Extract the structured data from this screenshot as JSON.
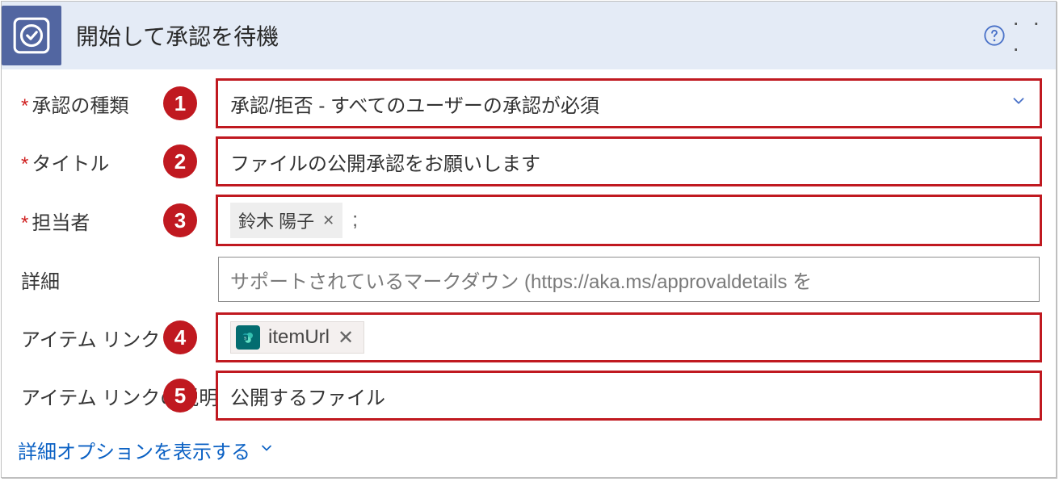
{
  "header": {
    "title": "開始して承認を待機",
    "icon_name": "approval-check-icon",
    "help_name": "help-icon",
    "more_name": "more-icon"
  },
  "rows": [
    {
      "label": "承認の種類",
      "required": true,
      "badge": "1",
      "highlight": true,
      "kind": "dropdown",
      "value": "承認/拒否 - すべてのユーザーの承認が必須"
    },
    {
      "label": "タイトル",
      "required": true,
      "badge": "2",
      "highlight": true,
      "kind": "text",
      "value": "ファイルの公開承認をお願いします"
    },
    {
      "label": "担当者",
      "required": true,
      "badge": "3",
      "highlight": true,
      "kind": "people",
      "chips": [
        {
          "name": "鈴木 陽子"
        }
      ],
      "separator": ";"
    },
    {
      "label": "詳細",
      "required": false,
      "badge": null,
      "highlight": false,
      "kind": "text",
      "placeholder": "サポートされているマークダウン (https://aka.ms/approvaldetails を"
    },
    {
      "label": "アイテム リンク",
      "required": false,
      "badge": "4",
      "highlight": true,
      "kind": "token",
      "token": {
        "label": "itemUrl",
        "icon_name": "sharepoint-icon"
      }
    },
    {
      "label": "アイテム リンクの説明",
      "required": false,
      "badge": "5",
      "highlight": true,
      "kind": "text",
      "value": "公開するファイル"
    }
  ],
  "footer": {
    "link_label": "詳細オプションを表示する"
  }
}
